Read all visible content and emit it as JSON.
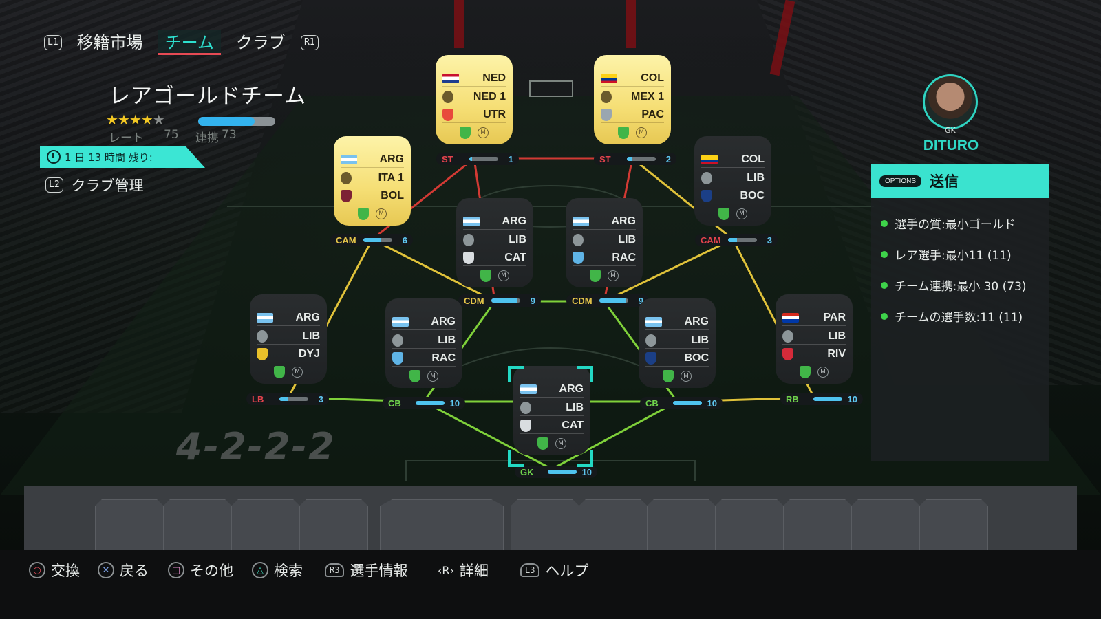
{
  "nav": {
    "left_button": "L1",
    "right_button": "R1",
    "tabs": [
      {
        "label": "移籍市場",
        "active": false
      },
      {
        "label": "チーム",
        "active": true
      },
      {
        "label": "クラブ",
        "active": false
      }
    ]
  },
  "team": {
    "name": "レアゴールドチーム",
    "stars_filled": 4,
    "stars_total": 5,
    "rating_label": "レート",
    "rating_value": "75",
    "chemistry_label": "連携",
    "chemistry_value": "73",
    "chemistry_fraction": 0.73,
    "timer_text": "1 日 13 時間 残り:",
    "club_button": "L2",
    "club_label": "クラブ管理",
    "formation": "4-2-2-2"
  },
  "players": [
    {
      "id": "st1",
      "style": "gold",
      "nation": "NED",
      "league": "NED 1",
      "club": "UTR",
      "flag": "ned",
      "crest": "#e8493b",
      "pos": "ST",
      "pos_color": "#e2434c",
      "chem": 1
    },
    {
      "id": "st2",
      "style": "gold",
      "nation": "COL",
      "league": "MEX 1",
      "club": "PAC",
      "flag": "col",
      "crest": "#9aa6b0",
      "pos": "ST",
      "pos_color": "#e2434c",
      "chem": 2
    },
    {
      "id": "camL",
      "style": "gold",
      "nation": "ARG",
      "league": "ITA 1",
      "club": "BOL",
      "flag": "arg",
      "crest": "#7d2235",
      "pos": "CAM",
      "pos_color": "#e6c64a",
      "chem": 6
    },
    {
      "id": "camR",
      "style": "dark",
      "nation": "COL",
      "league": "LIB",
      "club": "BOC",
      "flag": "col",
      "crest": "#1b3f86",
      "pos": "CAM",
      "pos_color": "#e2434c",
      "chem": 3
    },
    {
      "id": "cdmL",
      "style": "dark",
      "nation": "ARG",
      "league": "LIB",
      "club": "CAT",
      "flag": "arg",
      "crest": "#d9dde0",
      "pos": "CDM",
      "pos_color": "#e6c64a",
      "chem": 9
    },
    {
      "id": "cdmR",
      "style": "dark",
      "nation": "ARG",
      "league": "LIB",
      "club": "RAC",
      "flag": "arg",
      "crest": "#5fb4e6",
      "pos": "CDM",
      "pos_color": "#e6c64a",
      "chem": 9
    },
    {
      "id": "lb",
      "style": "dark",
      "nation": "ARG",
      "league": "LIB",
      "club": "DYJ",
      "flag": "arg",
      "crest": "#e9c02a",
      "pos": "LB",
      "pos_color": "#e2434c",
      "chem": 3
    },
    {
      "id": "cbL",
      "style": "dark",
      "nation": "ARG",
      "league": "LIB",
      "club": "RAC",
      "flag": "arg",
      "crest": "#5fb4e6",
      "pos": "CB",
      "pos_color": "#6fd34c",
      "chem": 10
    },
    {
      "id": "gk",
      "style": "dark",
      "nation": "ARG",
      "league": "LIB",
      "club": "CAT",
      "flag": "arg",
      "crest": "#d9dde0",
      "pos": "GK",
      "pos_color": "#6fd34c",
      "chem": 10
    },
    {
      "id": "cbR",
      "style": "dark",
      "nation": "ARG",
      "league": "LIB",
      "club": "BOC",
      "flag": "arg",
      "crest": "#1b3f86",
      "pos": "CB",
      "pos_color": "#6fd34c",
      "chem": 10
    },
    {
      "id": "rb",
      "style": "dark",
      "nation": "PAR",
      "league": "LIB",
      "club": "RIV",
      "flag": "par",
      "crest": "#d52b3a",
      "pos": "RB",
      "pos_color": "#6fd34c",
      "chem": 10
    }
  ],
  "selected": {
    "position": "GK",
    "name": "DITURO"
  },
  "panel": {
    "options_label": "OPTIONS",
    "submit_label": "送信",
    "requirements": [
      "選手の質:最小ゴールド",
      "レア選手:最小11 (11)",
      "チーム連携:最小 30 (73)",
      "チームの選手数:11 (11)"
    ]
  },
  "help": [
    {
      "icon": "○",
      "kind": "o",
      "label": "交換"
    },
    {
      "icon": "✕",
      "kind": "x",
      "label": "戻る"
    },
    {
      "icon": "□",
      "kind": "sq",
      "label": "その他"
    },
    {
      "icon": "△",
      "kind": "tri",
      "label": "検索"
    },
    {
      "icon": "R3",
      "kind": "stick",
      "label": "選手情報"
    },
    {
      "icon": "‹R›",
      "kind": "r",
      "label": "詳細"
    },
    {
      "icon": "L3",
      "kind": "stick",
      "label": "ヘルプ"
    }
  ],
  "colors": {
    "accent": "#2de0cf",
    "link_red": "#d23a34",
    "link_yellow": "#e0c23a",
    "link_green": "#7fd13a"
  }
}
